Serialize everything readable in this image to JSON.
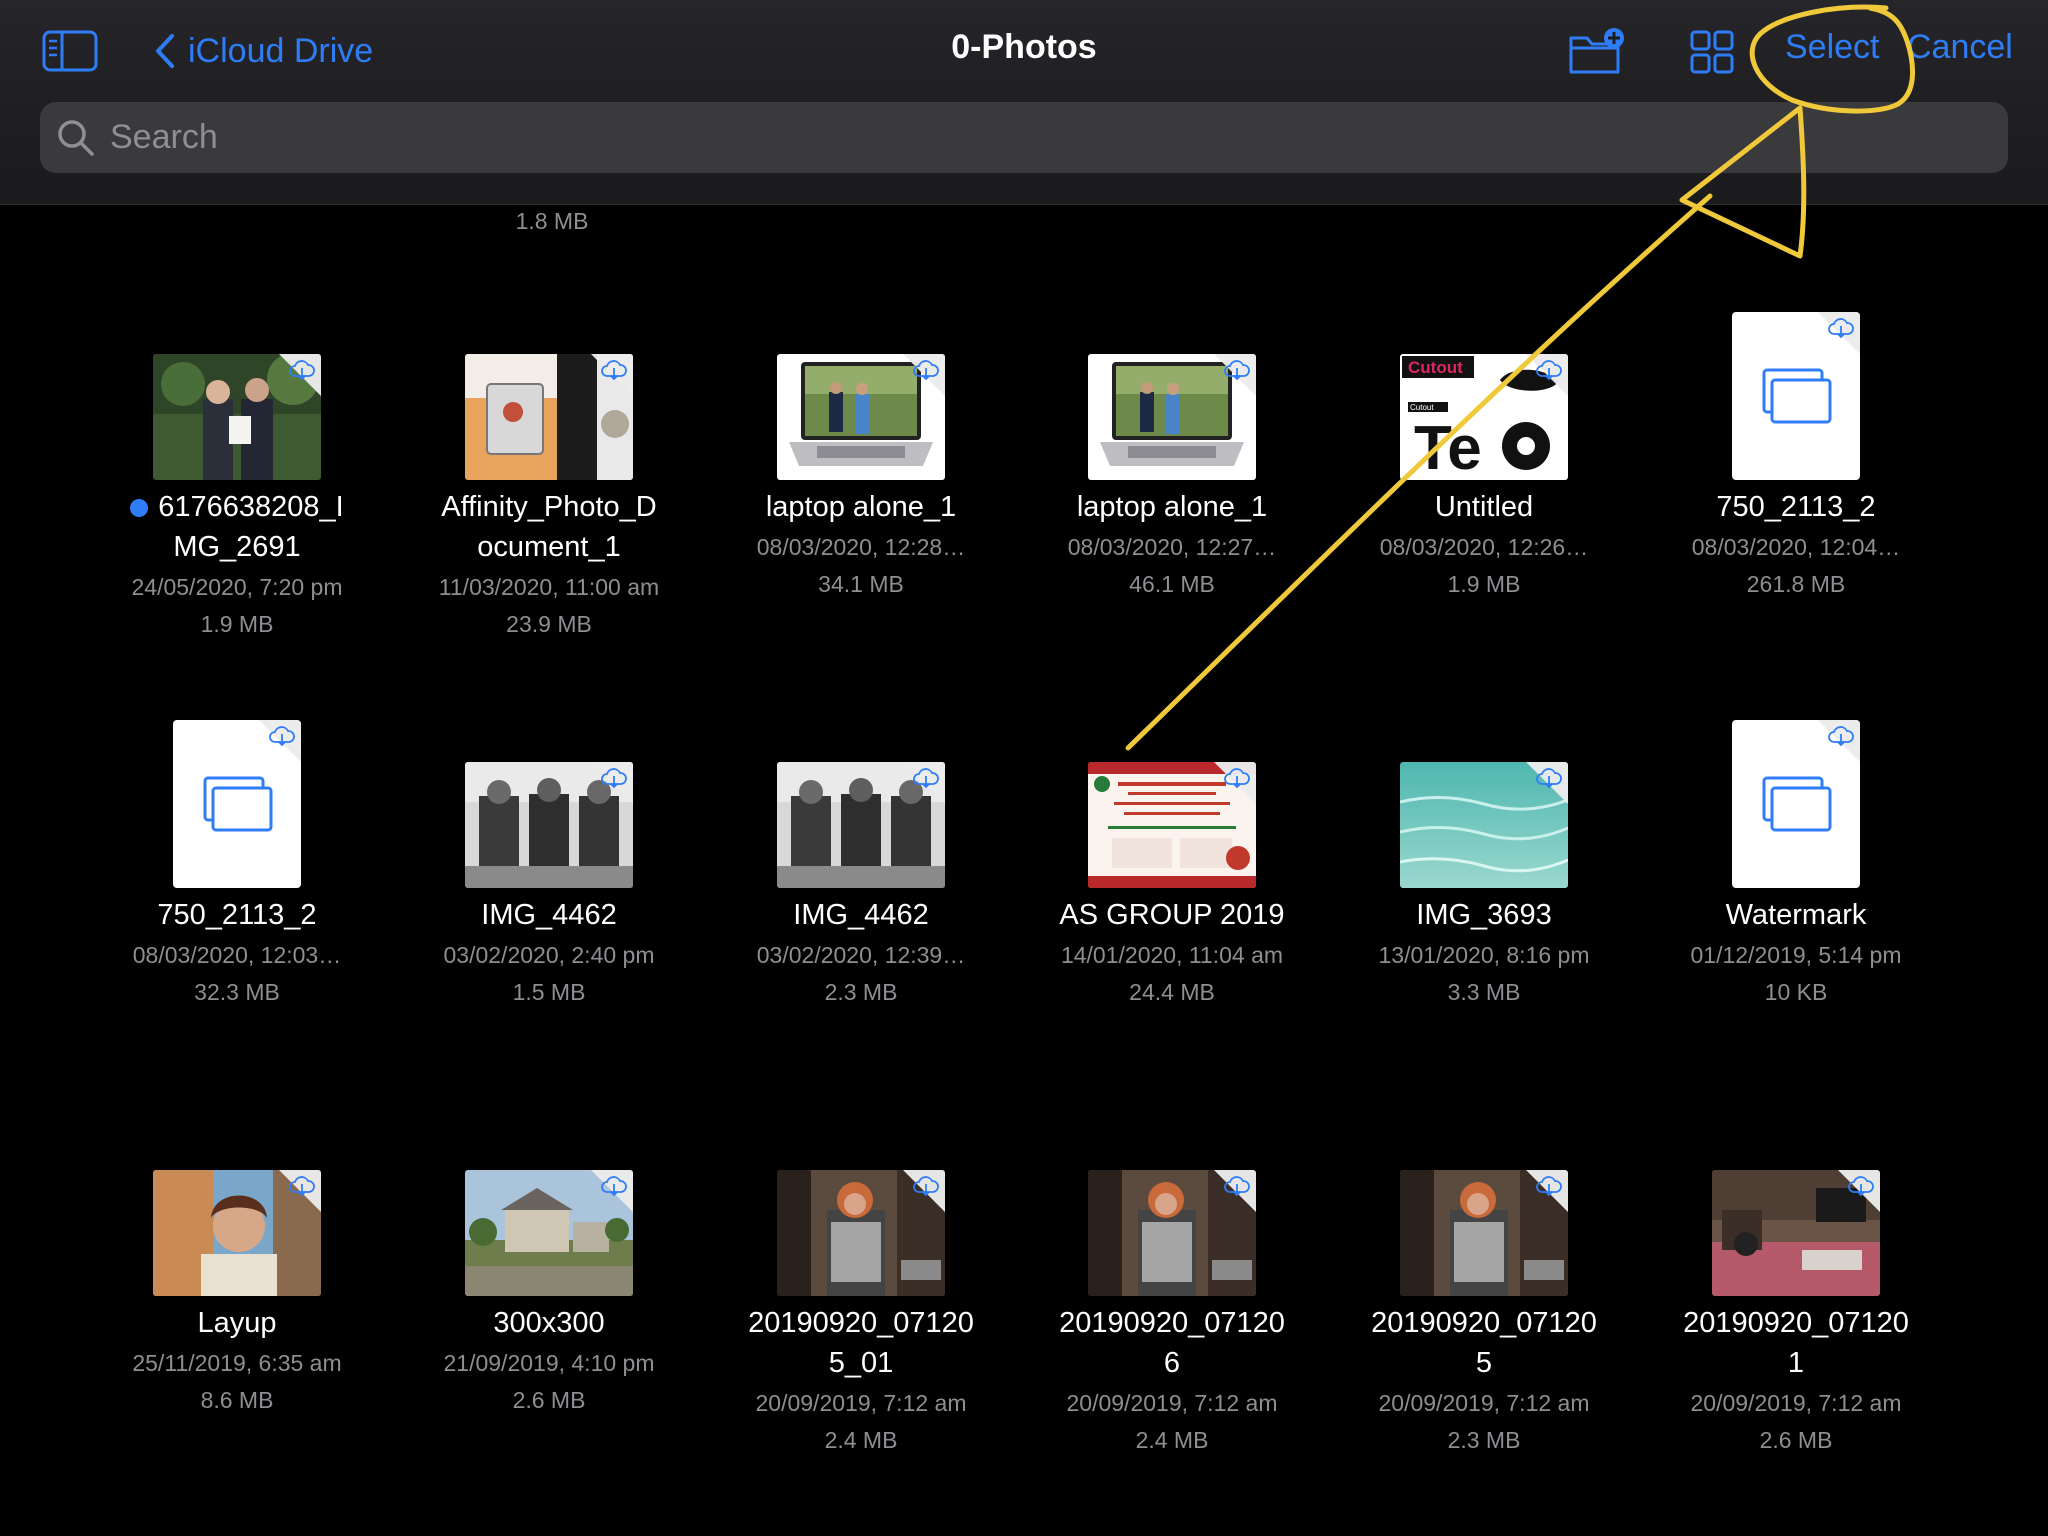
{
  "nav": {
    "back_label": "iCloud Drive",
    "title": "0-Photos",
    "select_label": "Select",
    "cancel_label": "Cancel",
    "accent_color": "#2f7df6"
  },
  "search": {
    "placeholder": "Search"
  },
  "top_partial_item": {
    "size": "1.8 MB"
  },
  "annotation_color": "#f0c93a",
  "rows": [
    [
      {
        "name": "6176638208_IMG_2691",
        "name_lines": [
          "6176638208_I",
          "MG_2691"
        ],
        "date": "24/05/2020, 7:20 pm",
        "size": "1.9 MB",
        "thumb": "photo-two-men-certificate",
        "tag_dot": true
      },
      {
        "name": "Affinity_Photo_Document_1",
        "name_lines": [
          "Affinity_Photo_D",
          "ocument_1"
        ],
        "date": "11/03/2020, 11:00 am",
        "size": "23.9 MB",
        "thumb": "desk-tablet-photo"
      },
      {
        "name": "laptop alone_1",
        "name_lines": [
          "laptop alone_1"
        ],
        "date": "08/03/2020, 12:28…",
        "size": "34.1 MB",
        "thumb": "laptop-photo"
      },
      {
        "name": "laptop alone_1",
        "name_lines": [
          "laptop alone_1"
        ],
        "date": "08/03/2020, 12:27…",
        "size": "46.1 MB",
        "thumb": "laptop-photo"
      },
      {
        "name": "Untitled",
        "name_lines": [
          "Untitled"
        ],
        "date": "08/03/2020, 12:26…",
        "size": "1.9 MB",
        "thumb": "cutout-graphic",
        "thumb_text": "Cutout"
      },
      {
        "name": "750_2113_2",
        "name_lines": [
          "750_2113_2"
        ],
        "date": "08/03/2020, 12:04…",
        "size": "261.8 MB",
        "thumb": "document"
      }
    ],
    [
      {
        "name": "750_2113_2",
        "name_lines": [
          "750_2113_2"
        ],
        "date": "08/03/2020, 12:03…",
        "size": "32.3 MB",
        "thumb": "document"
      },
      {
        "name": "IMG_4462",
        "name_lines": [
          "IMG_4462"
        ],
        "date": "03/02/2020, 2:40 pm",
        "size": "1.5 MB",
        "thumb": "bw-miners-photo"
      },
      {
        "name": "IMG_4462",
        "name_lines": [
          "IMG_4462"
        ],
        "date": "03/02/2020, 12:39…",
        "size": "2.3 MB",
        "thumb": "bw-miners-photo"
      },
      {
        "name": "AS GROUP 2019",
        "name_lines": [
          "AS GROUP 2019"
        ],
        "date": "14/01/2020, 11:04 am",
        "size": "24.4 MB",
        "thumb": "christmas-flyer"
      },
      {
        "name": "IMG_3693",
        "name_lines": [
          "IMG_3693"
        ],
        "date": "13/01/2020, 8:16 pm",
        "size": "3.3 MB",
        "thumb": "water-photo"
      },
      {
        "name": "Watermark",
        "name_lines": [
          "Watermark"
        ],
        "date": "01/12/2019, 5:14 pm",
        "size": "10 KB",
        "thumb": "document"
      }
    ],
    [
      {
        "name": "Layup",
        "name_lines": [
          "Layup"
        ],
        "date": "25/11/2019, 6:35 am",
        "size": "8.6 MB",
        "thumb": "portrait-photo"
      },
      {
        "name": "300x300",
        "name_lines": [
          "300x300"
        ],
        "date": "21/09/2019, 4:10 pm",
        "size": "2.6 MB",
        "thumb": "farmhouse-photo"
      },
      {
        "name": "20190920_071205_01",
        "name_lines": [
          "20190920_07120",
          "5_01"
        ],
        "date": "20/09/2019, 7:12 am",
        "size": "2.4 MB",
        "thumb": "room-photo"
      },
      {
        "name": "20190920_071206",
        "name_lines": [
          "20190920_07120",
          "6"
        ],
        "date": "20/09/2019, 7:12 am",
        "size": "2.4 MB",
        "thumb": "room-photo"
      },
      {
        "name": "20190920_071205",
        "name_lines": [
          "20190920_07120",
          "5"
        ],
        "date": "20/09/2019, 7:12 am",
        "size": "2.3 MB",
        "thumb": "room-photo"
      },
      {
        "name": "20190920_071201",
        "name_lines": [
          "20190920_07120",
          "1"
        ],
        "date": "20/09/2019, 7:12 am",
        "size": "2.6 MB",
        "thumb": "bedroom-photo"
      }
    ]
  ]
}
